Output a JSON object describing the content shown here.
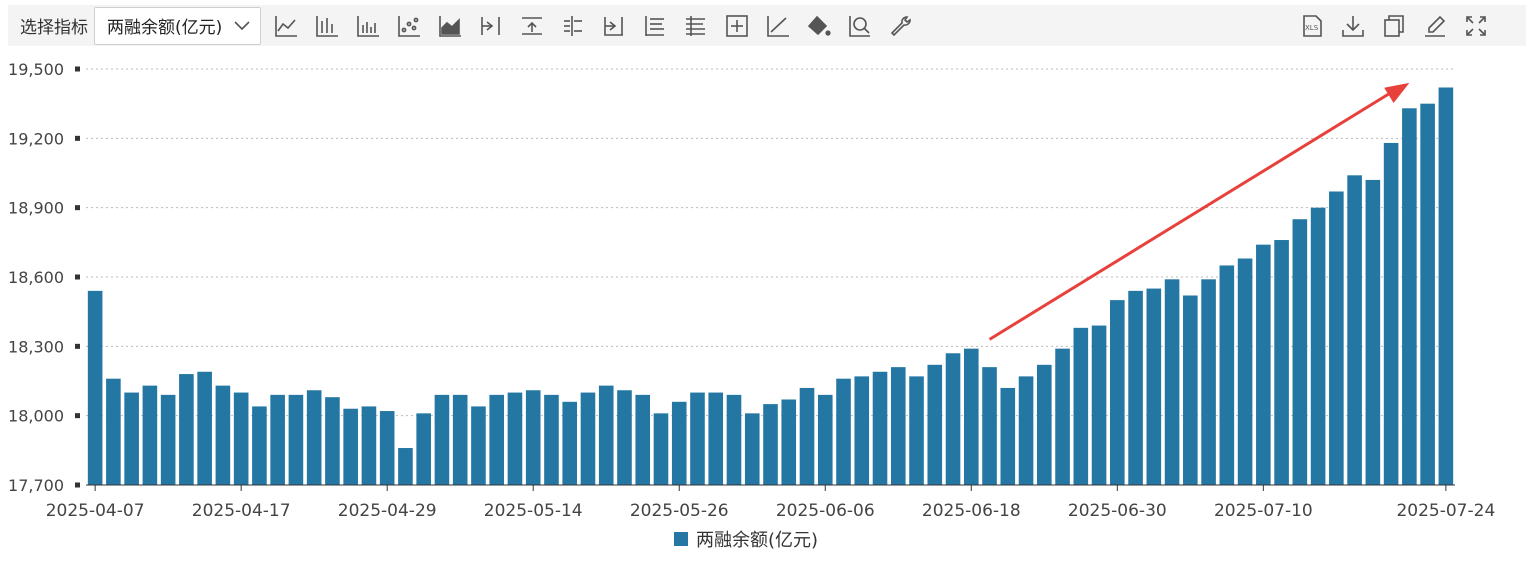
{
  "toolbar": {
    "label": "选择指标",
    "selected_indicator": "两融余额(亿元)",
    "left_icons": [
      "line-chart-icon",
      "bar-chart-icon",
      "stacked-bar-icon",
      "scatter-icon",
      "area-chart-icon",
      "align-right-icon",
      "align-top-icon",
      "align-middle-icon",
      "align-right-bar-icon",
      "list-icon",
      "stacked-list-icon",
      "crosshair-icon",
      "trend-line-icon",
      "fill-bucket-icon",
      "zoom-icon",
      "wrench-icon"
    ],
    "right_icons": [
      "export-xls-icon",
      "download-icon",
      "copy-icon",
      "edit-icon",
      "fullscreen-icon"
    ]
  },
  "chart_data": {
    "type": "bar",
    "title": "",
    "xlabel": "",
    "ylabel": "",
    "ylim": [
      17700,
      19500
    ],
    "yticks": [
      "17,700",
      "18,000",
      "18,300",
      "18,600",
      "18,900",
      "19,200",
      "19,500"
    ],
    "ytick_values": [
      17700,
      18000,
      18300,
      18600,
      18900,
      19200,
      19500
    ],
    "xtick_labels": [
      "2025-04-07",
      "2025-04-17",
      "2025-04-29",
      "2025-05-14",
      "2025-05-26",
      "2025-06-06",
      "2025-06-18",
      "2025-06-30",
      "2025-07-10",
      "2025-07-24"
    ],
    "xtick_indices": [
      0,
      8,
      16,
      24,
      32,
      40,
      48,
      56,
      64,
      74
    ],
    "grid": true,
    "legend_position": "bottom-center",
    "colors": {
      "bar": "#2577a3",
      "arrow": "#e8413c",
      "grid": "#bbbbbb"
    },
    "series": [
      {
        "name": "两融余额(亿元)",
        "values": [
          18540,
          18160,
          18100,
          18130,
          18090,
          18180,
          18190,
          18130,
          18100,
          18040,
          18090,
          18090,
          18110,
          18080,
          18030,
          18040,
          18020,
          17860,
          18010,
          18090,
          18090,
          18040,
          18090,
          18100,
          18110,
          18090,
          18060,
          18100,
          18130,
          18110,
          18090,
          18010,
          18060,
          18100,
          18100,
          18090,
          18010,
          18050,
          18070,
          18120,
          18090,
          18160,
          18170,
          18190,
          18210,
          18170,
          18220,
          18270,
          18290,
          18210,
          18120,
          18170,
          18220,
          18290,
          18380,
          18390,
          18500,
          18540,
          18550,
          18590,
          18520,
          18590,
          18650,
          18680,
          18740,
          18760,
          18850,
          18900,
          18970,
          19040,
          19020,
          19180,
          19330,
          19350,
          19420
        ]
      }
    ],
    "annotation": {
      "type": "arrow",
      "from_index": 49.5,
      "from_value": 18330,
      "to_index": 72.5,
      "to_value": 19440
    }
  }
}
